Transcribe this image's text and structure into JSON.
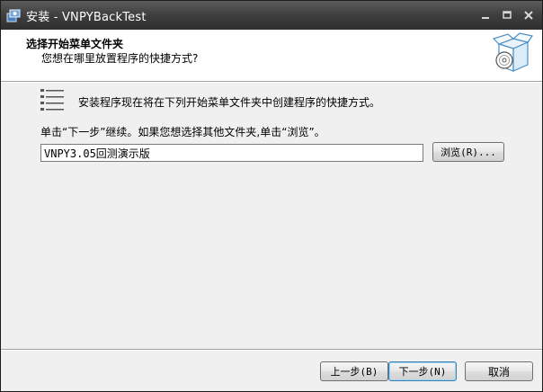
{
  "window": {
    "title": "安装 - VNPYBackTest"
  },
  "header": {
    "title": "选择开始菜单文件夹",
    "subtitle": "您想在哪里放置程序的快捷方式?"
  },
  "body": {
    "info_text": "安装程序现在将在下列开始菜单文件夹中创建程序的快捷方式。",
    "hint_text": "单击“下一步”继续。如果您想选择其他文件夹,单击“浏览”。",
    "folder_value": "VNPY3.05回测演示版",
    "browse_label": "浏览(R)..."
  },
  "footer": {
    "back_label": "上一步(B)",
    "next_label": "下一步(N)",
    "cancel_label": "取消"
  }
}
